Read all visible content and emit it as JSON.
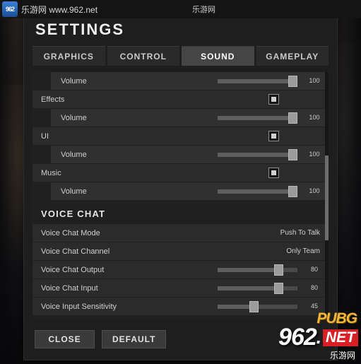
{
  "browser_bar": {
    "logo_text": "962",
    "site_label": "乐游网 www.962.net",
    "watermark_text": "乐游网"
  },
  "settings": {
    "title": "SETTINGS",
    "tabs": [
      {
        "label": "GRAPHICS",
        "active": false
      },
      {
        "label": "CONTROL",
        "active": false
      },
      {
        "label": "SOUND",
        "active": true
      },
      {
        "label": "GAMEPLAY",
        "active": false
      }
    ],
    "rows": [
      {
        "type": "slider",
        "label": "Volume",
        "value": "100",
        "fill": 100,
        "indent": true
      },
      {
        "type": "toggle",
        "label": "Effects",
        "checked": true,
        "indent": false
      },
      {
        "type": "slider",
        "label": "Volume",
        "value": "100",
        "fill": 100,
        "indent": true
      },
      {
        "type": "toggle",
        "label": "UI",
        "checked": true,
        "indent": false
      },
      {
        "type": "slider",
        "label": "Volume",
        "value": "100",
        "fill": 100,
        "indent": true
      },
      {
        "type": "toggle",
        "label": "Music",
        "checked": true,
        "indent": false
      },
      {
        "type": "slider",
        "label": "Volume",
        "value": "100",
        "fill": 100,
        "indent": true
      }
    ],
    "voice_section": {
      "title": "VOICE CHAT",
      "rows": [
        {
          "type": "value",
          "label": "Voice Chat Mode",
          "value": "Push To Talk"
        },
        {
          "type": "value",
          "label": "Voice Chat Channel",
          "value": "Only Team"
        },
        {
          "type": "slider",
          "label": "Voice Chat Output",
          "value": "80",
          "fill": 80
        },
        {
          "type": "slider",
          "label": "Voice Chat Input",
          "value": "80",
          "fill": 80
        },
        {
          "type": "slider",
          "label": "Voice Input Sensitivity",
          "value": "45",
          "fill": 45
        }
      ]
    },
    "buttons": [
      {
        "label": "CLOSE"
      },
      {
        "label": "DEFAULT"
      }
    ]
  },
  "watermark": {
    "pubg": "PUBG",
    "num": "962",
    "dot": ".",
    "net": "NET",
    "sub": "乐游网"
  }
}
